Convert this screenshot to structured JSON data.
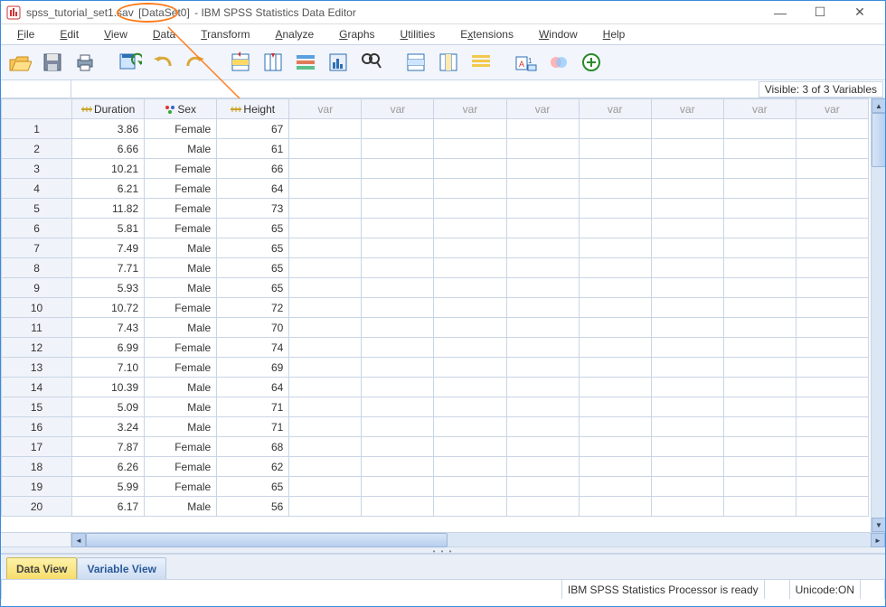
{
  "window": {
    "filename": "spss_tutorial_set1.sav",
    "dataset_tag": "[DataSet0]",
    "app_suffix": " - IBM SPSS Statistics Data Editor"
  },
  "menu": {
    "items": [
      {
        "underline": "F",
        "rest": "ile"
      },
      {
        "underline": "E",
        "rest": "dit"
      },
      {
        "underline": "V",
        "rest": "iew"
      },
      {
        "underline": "D",
        "rest": "ata"
      },
      {
        "underline": "T",
        "rest": "ransform"
      },
      {
        "underline": "A",
        "rest": "nalyze"
      },
      {
        "underline": "G",
        "rest": "raphs"
      },
      {
        "underline": "U",
        "rest": "tilities"
      },
      {
        "underline": "E",
        "pre": "",
        "rest": "xtensions",
        "u2": "x",
        "text": "Extensions"
      },
      {
        "underline": "W",
        "rest": "indow"
      },
      {
        "underline": "H",
        "rest": "elp"
      }
    ]
  },
  "toolbar": {
    "icons": [
      "open-icon",
      "save-icon",
      "print-icon",
      "",
      "recall-icon",
      "undo-icon",
      "redo-icon",
      "",
      "goto-case-icon",
      "goto-var-icon",
      "variables-icon",
      "run-desc-icon",
      "find-icon",
      "",
      "insert-case-icon",
      "insert-var-icon",
      "split-file-icon",
      "",
      "weight-icon",
      "select-cases-icon",
      "value-labels-icon"
    ]
  },
  "infobar": {
    "visible_text": "Visible: 3 of 3 Variables"
  },
  "columns": [
    {
      "name": "Duration",
      "type": "scale"
    },
    {
      "name": "Sex",
      "type": "nominal"
    },
    {
      "name": "Height",
      "type": "scale"
    }
  ],
  "empty_col_label": "var",
  "rows": [
    {
      "n": 1,
      "Duration": "3.86",
      "Sex": "Female",
      "Height": "67"
    },
    {
      "n": 2,
      "Duration": "6.66",
      "Sex": "Male",
      "Height": "61"
    },
    {
      "n": 3,
      "Duration": "10.21",
      "Sex": "Female",
      "Height": "66"
    },
    {
      "n": 4,
      "Duration": "6.21",
      "Sex": "Female",
      "Height": "64"
    },
    {
      "n": 5,
      "Duration": "11.82",
      "Sex": "Female",
      "Height": "73"
    },
    {
      "n": 6,
      "Duration": "5.81",
      "Sex": "Female",
      "Height": "65"
    },
    {
      "n": 7,
      "Duration": "7.49",
      "Sex": "Male",
      "Height": "65"
    },
    {
      "n": 8,
      "Duration": "7.71",
      "Sex": "Male",
      "Height": "65"
    },
    {
      "n": 9,
      "Duration": "5.93",
      "Sex": "Male",
      "Height": "65"
    },
    {
      "n": 10,
      "Duration": "10.72",
      "Sex": "Female",
      "Height": "72"
    },
    {
      "n": 11,
      "Duration": "7.43",
      "Sex": "Male",
      "Height": "70"
    },
    {
      "n": 12,
      "Duration": "6.99",
      "Sex": "Female",
      "Height": "74"
    },
    {
      "n": 13,
      "Duration": "7.10",
      "Sex": "Female",
      "Height": "69"
    },
    {
      "n": 14,
      "Duration": "10.39",
      "Sex": "Male",
      "Height": "64"
    },
    {
      "n": 15,
      "Duration": "5.09",
      "Sex": "Male",
      "Height": "71"
    },
    {
      "n": 16,
      "Duration": "3.24",
      "Sex": "Male",
      "Height": "71"
    },
    {
      "n": 17,
      "Duration": "7.87",
      "Sex": "Female",
      "Height": "68"
    },
    {
      "n": 18,
      "Duration": "6.26",
      "Sex": "Female",
      "Height": "62"
    },
    {
      "n": 19,
      "Duration": "5.99",
      "Sex": "Female",
      "Height": "65"
    },
    {
      "n": 20,
      "Duration": "6.17",
      "Sex": "Male",
      "Height": "56"
    }
  ],
  "tabs": {
    "data_view": "Data View",
    "variable_view": "Variable View"
  },
  "status": {
    "processor": "IBM SPSS Statistics Processor is ready",
    "unicode": "Unicode:ON"
  }
}
